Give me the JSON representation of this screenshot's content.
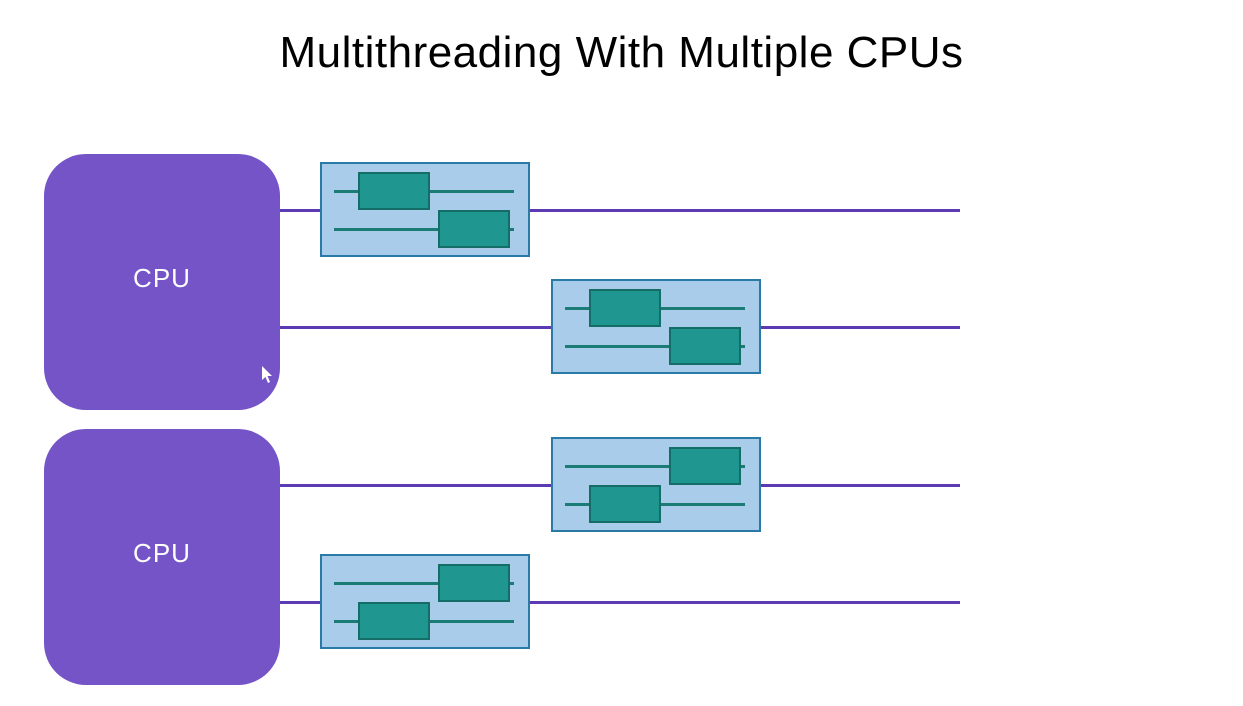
{
  "title": "Multithreading With Multiple CPUs",
  "cpus": [
    {
      "label": "CPU"
    },
    {
      "label": "CPU"
    }
  ],
  "colors": {
    "cpu_fill": "#7454c7",
    "timeline": "#5b3ab3",
    "thread_fill": "#a8cce9",
    "thread_border": "#2a7aa8",
    "task_fill": "#1f9690",
    "task_border": "#156d68",
    "task_line": "#1b7c75"
  }
}
